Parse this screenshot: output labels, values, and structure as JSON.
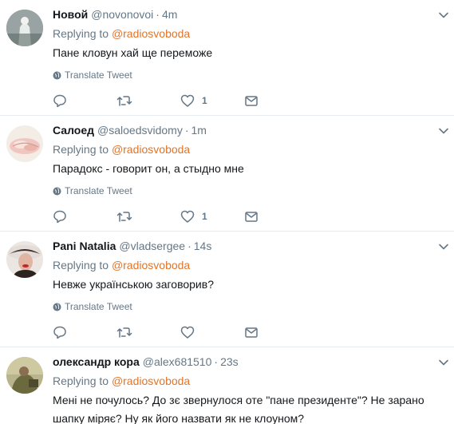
{
  "tweets": [
    {
      "fullname": "Новой",
      "handle": "@novonovoi",
      "time": "4m",
      "reply_prefix": "Replying to",
      "reply_to": "@radiosvoboda",
      "text": "Пане кловун хай ще переможе",
      "translate": "Translate Tweet",
      "likes": "1"
    },
    {
      "fullname": "Салоед",
      "handle": "@saloedsvidomy",
      "time": "1m",
      "reply_prefix": "Replying to",
      "reply_to": "@radiosvoboda",
      "text": "Парадокс - говорит он, а стыдно мне",
      "translate": "Translate Tweet",
      "likes": "1"
    },
    {
      "fullname": "Pani Natalia",
      "handle": "@vladsergee",
      "time": "14s",
      "reply_prefix": "Replying to",
      "reply_to": "@radiosvoboda",
      "text": "Невже українською заговорив?",
      "translate": "Translate Tweet",
      "likes": ""
    },
    {
      "fullname": "олександр кора",
      "handle": "@alex681510",
      "time": "23s",
      "reply_prefix": "Replying to",
      "reply_to": "@radiosvoboda",
      "text_line1": "Мені не почулось? До зє звернулося оте \"пане президенте\"? Не зарано",
      "text_line2": "шапку міряє? Ну як його назвати як не клоуном?"
    }
  ],
  "colors": {
    "mention": "#e0752b",
    "secondary": "#657786",
    "divider": "#e6ecf0"
  }
}
